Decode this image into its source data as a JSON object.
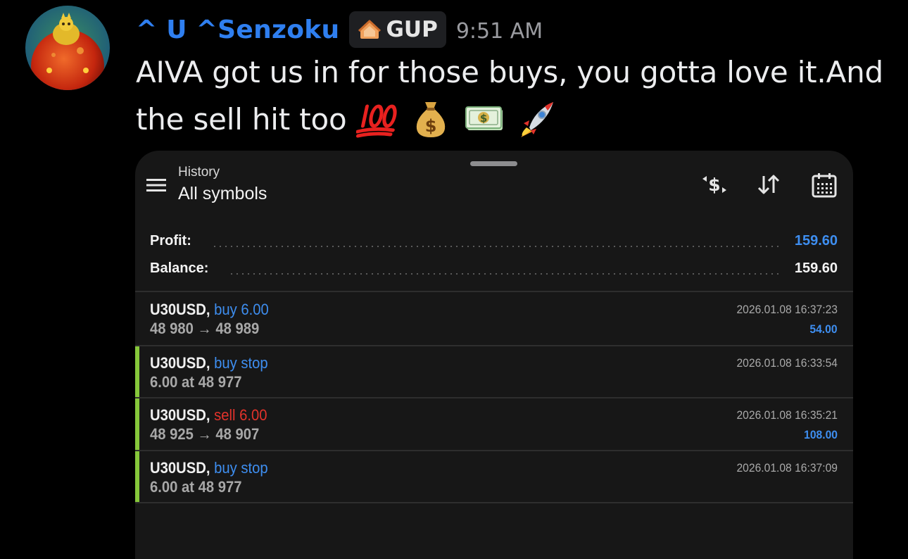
{
  "message": {
    "username": "^ U ^Senzoku",
    "tag": "GUP",
    "timestamp": "9:51 AM",
    "text_line1": "AIVA got us in for those buys, you gotta love it.And",
    "text_line2": "the sell hit too",
    "emojis": [
      "hundred-points-emoji",
      "money-bag-emoji",
      "dollar-banknote-emoji",
      "rocket-emoji"
    ]
  },
  "history": {
    "subtitle": "History",
    "title": "All symbols",
    "toolbar_icons": [
      "currency-swap-icon",
      "sort-icon",
      "calendar-icon"
    ],
    "summary": {
      "profit_label": "Profit:",
      "profit_value": "159.60",
      "balance_label": "Balance:",
      "balance_value": "159.60"
    },
    "deals": [
      {
        "symbol": "U30USD,",
        "action": "buy 6.00",
        "action_color": "#3e8ef0",
        "detail": "48 980 → 48 989",
        "time": "2026.01.08 16:37:23",
        "amount": "54.00",
        "accent": false
      },
      {
        "symbol": "U30USD,",
        "action": "buy stop",
        "action_color": "#3e8ef0",
        "detail": "6.00 at 48 977",
        "time": "2026.01.08 16:33:54",
        "amount": "",
        "accent": true
      },
      {
        "symbol": "U30USD,",
        "action": "sell 6.00",
        "action_color": "#e2332b",
        "detail": "48 925 → 48 907",
        "time": "2026.01.08 16:35:21",
        "amount": "108.00",
        "accent": true
      },
      {
        "symbol": "U30USD,",
        "action": "buy stop",
        "action_color": "#3e8ef0",
        "detail": "6.00 at 48 977",
        "time": "2026.01.08 16:37:09",
        "amount": "",
        "accent": true
      }
    ]
  },
  "colors": {
    "username": "#2f7ff0",
    "profit": "#3e8ef0",
    "accent_bar": "#86c73a"
  }
}
